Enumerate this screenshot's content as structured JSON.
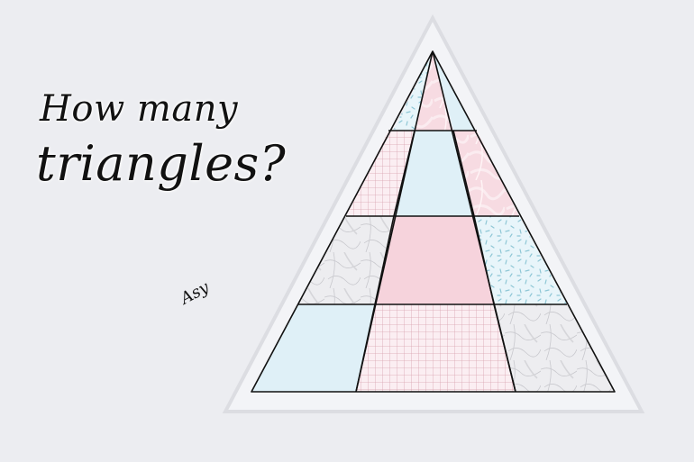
{
  "title": {
    "line1": "How many",
    "line2": "triangles?"
  },
  "signature": "Asy",
  "colors": {
    "background": "#ecedf1",
    "outer_triangle": "#f3f4f7",
    "outer_triangle_edge": "#dcdde2",
    "pastel_blue": "#dff0f7",
    "pastel_pink": "#f6d3dc",
    "grid_pink": "#d9a3b0",
    "marble": "#e9e9ec",
    "line": "#111111"
  },
  "tile_patterns": [
    [
      "marble-pink",
      "blue"
    ],
    [
      "grid",
      "blue",
      "marble-pink"
    ],
    [
      "marble-grey",
      "pink",
      "dash-blue"
    ],
    [
      "blue",
      "grid",
      "marble-grey"
    ]
  ]
}
